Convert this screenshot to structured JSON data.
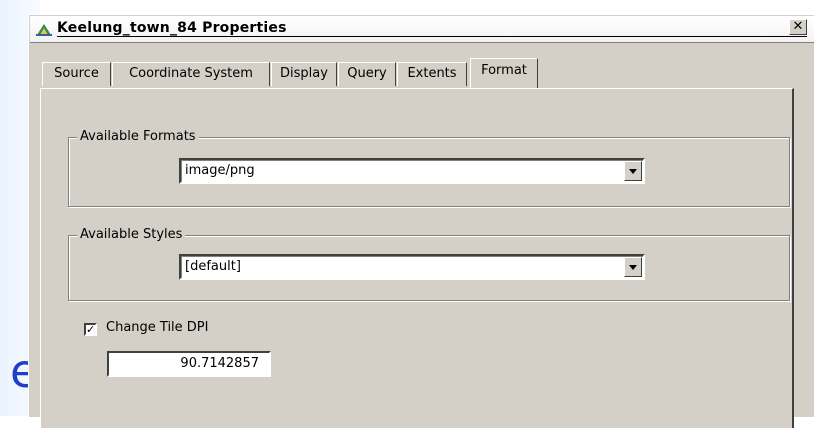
{
  "window": {
    "title": "Keelung_town_84 Properties",
    "close_label": "✕"
  },
  "tabs": [
    {
      "label": "Source",
      "active": false
    },
    {
      "label": "Coordinate System",
      "active": false
    },
    {
      "label": "Display",
      "active": false
    },
    {
      "label": "Query",
      "active": false
    },
    {
      "label": "Extents",
      "active": false
    },
    {
      "label": "Format",
      "active": true
    }
  ],
  "formats": {
    "legend": "Available Formats",
    "selected": "image/png"
  },
  "styles": {
    "legend": "Available Styles",
    "selected": "[default]"
  },
  "dpi": {
    "checkbox_label": "Change Tile DPI",
    "checked": true,
    "check_glyph": "✓",
    "value": "90.7142857"
  },
  "background": {
    "visible_letter": "e"
  }
}
